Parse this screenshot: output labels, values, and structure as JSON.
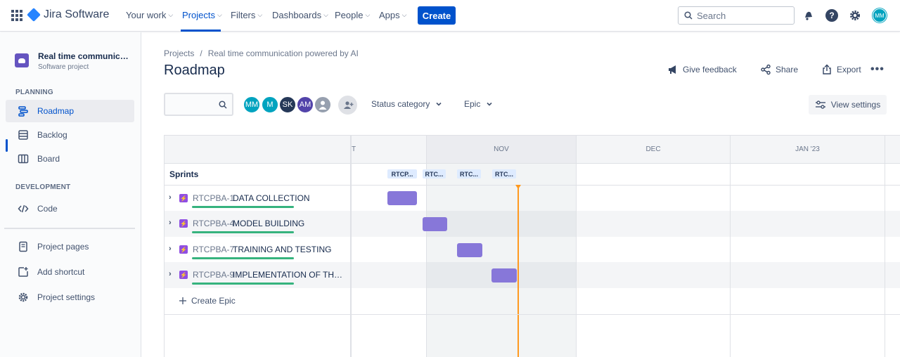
{
  "topnav": {
    "app_name": "Jira Software",
    "items": [
      {
        "label": "Your work"
      },
      {
        "label": "Projects"
      },
      {
        "label": "Filters"
      },
      {
        "label": "Dashboards"
      },
      {
        "label": "People"
      },
      {
        "label": "Apps"
      }
    ],
    "create_label": "Create",
    "search_placeholder": "Search",
    "user_initials": "MM"
  },
  "sidebar": {
    "project_name": "Real time communicati...",
    "project_type": "Software project",
    "planning_label": "PLANNING",
    "development_label": "DEVELOPMENT",
    "items": [
      {
        "label": "Roadmap",
        "icon": "roadmap-icon"
      },
      {
        "label": "Backlog",
        "icon": "backlog-icon"
      },
      {
        "label": "Board",
        "icon": "board-icon"
      },
      {
        "label": "Code",
        "icon": "code-icon"
      },
      {
        "label": "Project pages",
        "icon": "page-icon"
      },
      {
        "label": "Add shortcut",
        "icon": "add-shortcut-icon"
      },
      {
        "label": "Project settings",
        "icon": "gear-icon"
      }
    ]
  },
  "header": {
    "breadcrumb": [
      "Projects",
      "/",
      "Real time communication powered by AI"
    ],
    "title": "Roadmap",
    "give_feedback": "Give feedback",
    "share": "Share",
    "export": "Export"
  },
  "filters": {
    "avatars": [
      {
        "initials": "MM",
        "color": "#00a3bf"
      },
      {
        "initials": "M",
        "color": "#00a3bf"
      },
      {
        "initials": "SK",
        "color": "#253858"
      },
      {
        "initials": "AM",
        "color": "#5243aa"
      },
      {
        "initials": "",
        "color": "#97a0af"
      }
    ],
    "status_category": "Status category",
    "epic": "Epic",
    "view_settings": "View settings"
  },
  "roadmap": {
    "months": [
      "T",
      "NOV",
      "DEC",
      "JAN '23"
    ],
    "sprints_label": "Sprints",
    "sprints": [
      "RTCP...",
      "RTC...",
      "RTC...",
      "RTC..."
    ],
    "epics": [
      {
        "key": "RTCPBA-1",
        "title": "DATA COLLECTION"
      },
      {
        "key": "RTCPBA-4",
        "title": "MODEL BUILDING"
      },
      {
        "key": "RTCPBA-7",
        "title": "TRAINING AND TESTING"
      },
      {
        "key": "RTCPBA-9",
        "title": "IMPLEMENTATION OF THE A..."
      }
    ],
    "create_epic": "Create Epic"
  },
  "colors": {
    "brand": "#0052cc",
    "epic_bar": "#8777d9",
    "today_line": "#ff991f",
    "progress": "#36b37e"
  }
}
